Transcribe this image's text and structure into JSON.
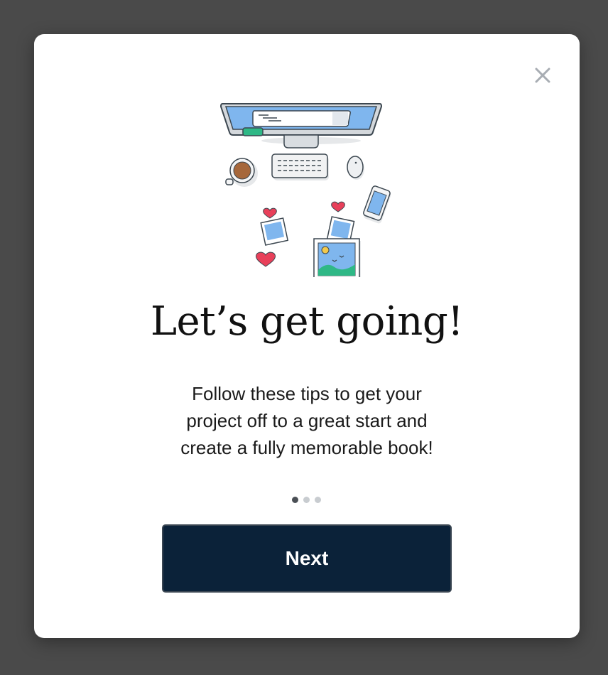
{
  "modal": {
    "title": "Let’s get going!",
    "description": "Follow these tips to get your project off to a great start and create a fully memorable book!",
    "next_label": "Next",
    "close_icon": "close-icon",
    "pagination": {
      "current": 1,
      "total": 3
    },
    "illustration": "desk-workspace-illustration"
  },
  "colors": {
    "overlay": "#4a4a4a",
    "button_bg": "#0b2239",
    "dot_active": "#4a4f55",
    "dot_inactive": "#c8ccd0"
  }
}
